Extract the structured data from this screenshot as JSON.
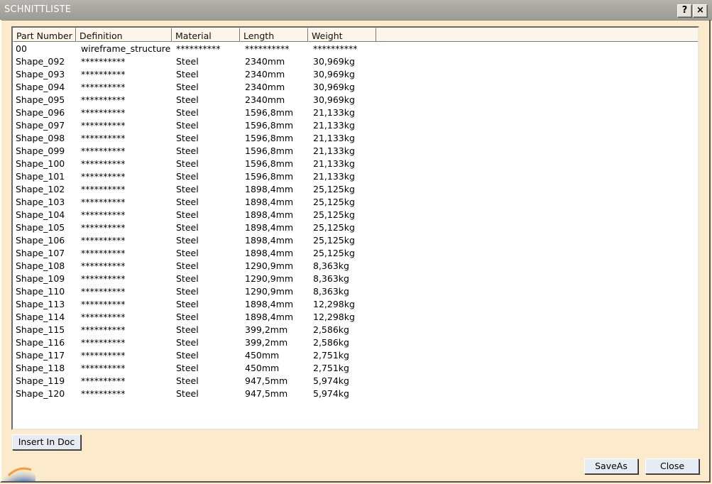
{
  "window": {
    "title": "SCHNITTLISTE",
    "help_label": "?",
    "close_label": "×"
  },
  "table": {
    "columns": [
      "Part Number",
      "Definition",
      "Material",
      "Length",
      "Weight"
    ],
    "rows": [
      [
        "00",
        "wireframe_structure",
        "**********",
        "**********",
        "**********"
      ],
      [
        "Shape_092",
        "**********",
        "Steel",
        "2340mm",
        "30,969kg"
      ],
      [
        "Shape_093",
        "**********",
        "Steel",
        "2340mm",
        "30,969kg"
      ],
      [
        "Shape_094",
        "**********",
        "Steel",
        "2340mm",
        "30,969kg"
      ],
      [
        "Shape_095",
        "**********",
        "Steel",
        "2340mm",
        "30,969kg"
      ],
      [
        "Shape_096",
        "**********",
        "Steel",
        "1596,8mm",
        "21,133kg"
      ],
      [
        "Shape_097",
        "**********",
        "Steel",
        "1596,8mm",
        "21,133kg"
      ],
      [
        "Shape_098",
        "**********",
        "Steel",
        "1596,8mm",
        "21,133kg"
      ],
      [
        "Shape_099",
        "**********",
        "Steel",
        "1596,8mm",
        "21,133kg"
      ],
      [
        "Shape_100",
        "**********",
        "Steel",
        "1596,8mm",
        "21,133kg"
      ],
      [
        "Shape_101",
        "**********",
        "Steel",
        "1596,8mm",
        "21,133kg"
      ],
      [
        "Shape_102",
        "**********",
        "Steel",
        "1898,4mm",
        "25,125kg"
      ],
      [
        "Shape_103",
        "**********",
        "Steel",
        "1898,4mm",
        "25,125kg"
      ],
      [
        "Shape_104",
        "**********",
        "Steel",
        "1898,4mm",
        "25,125kg"
      ],
      [
        "Shape_105",
        "**********",
        "Steel",
        "1898,4mm",
        "25,125kg"
      ],
      [
        "Shape_106",
        "**********",
        "Steel",
        "1898,4mm",
        "25,125kg"
      ],
      [
        "Shape_107",
        "**********",
        "Steel",
        "1898,4mm",
        "25,125kg"
      ],
      [
        "Shape_108",
        "**********",
        "Steel",
        "1290,9mm",
        "8,363kg"
      ],
      [
        "Shape_109",
        "**********",
        "Steel",
        "1290,9mm",
        "8,363kg"
      ],
      [
        "Shape_110",
        "**********",
        "Steel",
        "1290,9mm",
        "8,363kg"
      ],
      [
        "Shape_113",
        "**********",
        "Steel",
        "1898,4mm",
        "12,298kg"
      ],
      [
        "Shape_114",
        "**********",
        "Steel",
        "1898,4mm",
        "12,298kg"
      ],
      [
        "Shape_115",
        "**********",
        "Steel",
        "399,2mm",
        "2,586kg"
      ],
      [
        "Shape_116",
        "**********",
        "Steel",
        "399,2mm",
        "2,586kg"
      ],
      [
        "Shape_117",
        "**********",
        "Steel",
        "450mm",
        "2,751kg"
      ],
      [
        "Shape_118",
        "**********",
        "Steel",
        "450mm",
        "2,751kg"
      ],
      [
        "Shape_119",
        "**********",
        "Steel",
        "947,5mm",
        "5,974kg"
      ],
      [
        "Shape_120",
        "**********",
        "Steel",
        "947,5mm",
        "5,974kg"
      ]
    ]
  },
  "buttons": {
    "insert": "Insert In Doc",
    "save_as": "SaveAs",
    "close": "Close"
  },
  "icons": {
    "logo": "catia-logo-icon"
  },
  "colors": {
    "dialog_background": "#fbeacb",
    "titlebar": "#a8a7a1",
    "button_face": "#e6ebf4",
    "list_background": "#ffffff",
    "header_background": "#fbf5ea"
  }
}
